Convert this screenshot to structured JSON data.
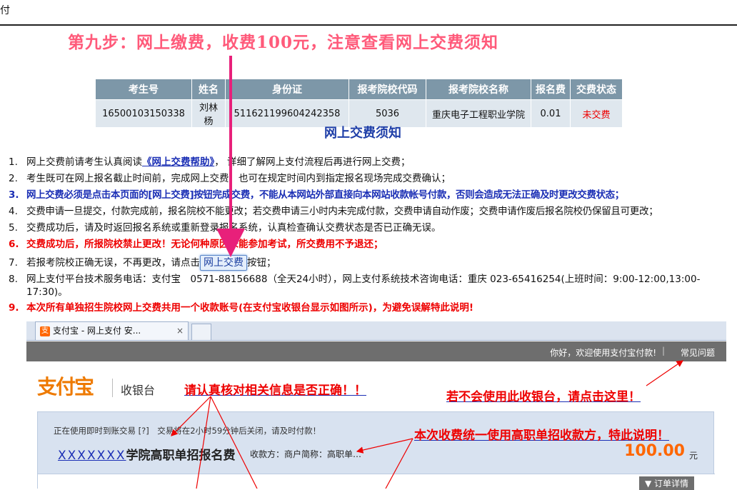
{
  "page_fragment": "付",
  "step_title": "第九步：网上缴费，收费100元，注意查看网上交费须知",
  "table": {
    "headers": [
      "考生号",
      "姓名",
      "身份证",
      "报考院校代码",
      "报考院校名称",
      "报名费",
      "交费状态"
    ],
    "row": [
      "16500103150338",
      "刘林杨",
      "511621199604242358",
      "5036",
      "重庆电子工程职业学院",
      "0.01",
      "未交费"
    ]
  },
  "notice_title": "网上交费须知",
  "notices": {
    "n1": {
      "num": "1.",
      "pre": "网上交费前请考生认真阅读",
      "link": "《网上交费帮助》",
      "post": "， 详细了解网上支付流程后再进行网上交费；"
    },
    "n2": {
      "num": "2.",
      "text": "考生既可在网上报名截止时间前，完成网上交费，也可在规定时间内到指定报名现场完成交费确认；"
    },
    "n3": {
      "num": "3.",
      "text": "网上交费必须是点击本页面的[网上交费]按钮完成交费，不能从本网站外部直接向本网站收款帐号付款，否则会造成无法正确及时更改交费状态；"
    },
    "n4": {
      "num": "4.",
      "text": "交费申请一旦提交，付款完成前，报名院校不能更改；若交费申请三小时内未完成付款，交费申请自动作废；交费申请作废后报名院校仍保留且可更改；"
    },
    "n5": {
      "num": "5.",
      "text": "交费成功后，请及时返回报名系统或重新登录报名系统，认真检查确认交费状态是否已正确无误。"
    },
    "n6": {
      "num": "6.",
      "text": "交费成功后，所报院校禁止更改！无论何种原因未能参加考试，所交费用不予退还；"
    },
    "n7": {
      "num": "7.",
      "pre": "若报考院校正确无误，不再更改，请点击",
      "button": "网上交费",
      "post": "按钮；"
    },
    "n8": {
      "num": "8.",
      "text": "网上支付平台技术服务电话：支付宝　0571-88156688（全天24小时），网上支付系统技术咨询电话：重庆 023-65416254(上班时间：9:00-12:00,13:00-17:30)。"
    },
    "n9": {
      "num": "9.",
      "text": "本次所有单独招生院校网上交费共用一个收款账号(在支付宝收银台显示如图所示)，为避免误解特此说明!"
    }
  },
  "cashier": {
    "tab_title": "支付宝 - 网上支付 安...",
    "tab_close": "×",
    "welcome": "你好，欢迎使用支付宝付款!",
    "separator": "|",
    "faq": "常见问题",
    "logo": "支付宝",
    "cashier_label": "收银台",
    "trade_info": "正在使用即时到账交易 [?]　交易将在2小时59分钟后关闭，请及时付款！",
    "school_mask": "XXXXXXX",
    "school_suffix": "学院高职单招报名费",
    "payee": "收款方：商户简称：高职单…",
    "amount": "100.00",
    "yuan": "元",
    "order_detail": "▼ 订单详情"
  },
  "annotations": {
    "verify": "请认真核对相关信息是否正确！！",
    "faq_hint": "若不会使用此收银台，请点击这里！",
    "payee_note": "本次收费统一使用高职单招收款方，特此说明！"
  },
  "colors": {
    "header_bg": "#7d97a8",
    "title_pink": "#ff5a7a",
    "alert_red": "#ee0000",
    "link_blue": "#1b2fb5",
    "alipay_orange": "#ee7a00"
  }
}
